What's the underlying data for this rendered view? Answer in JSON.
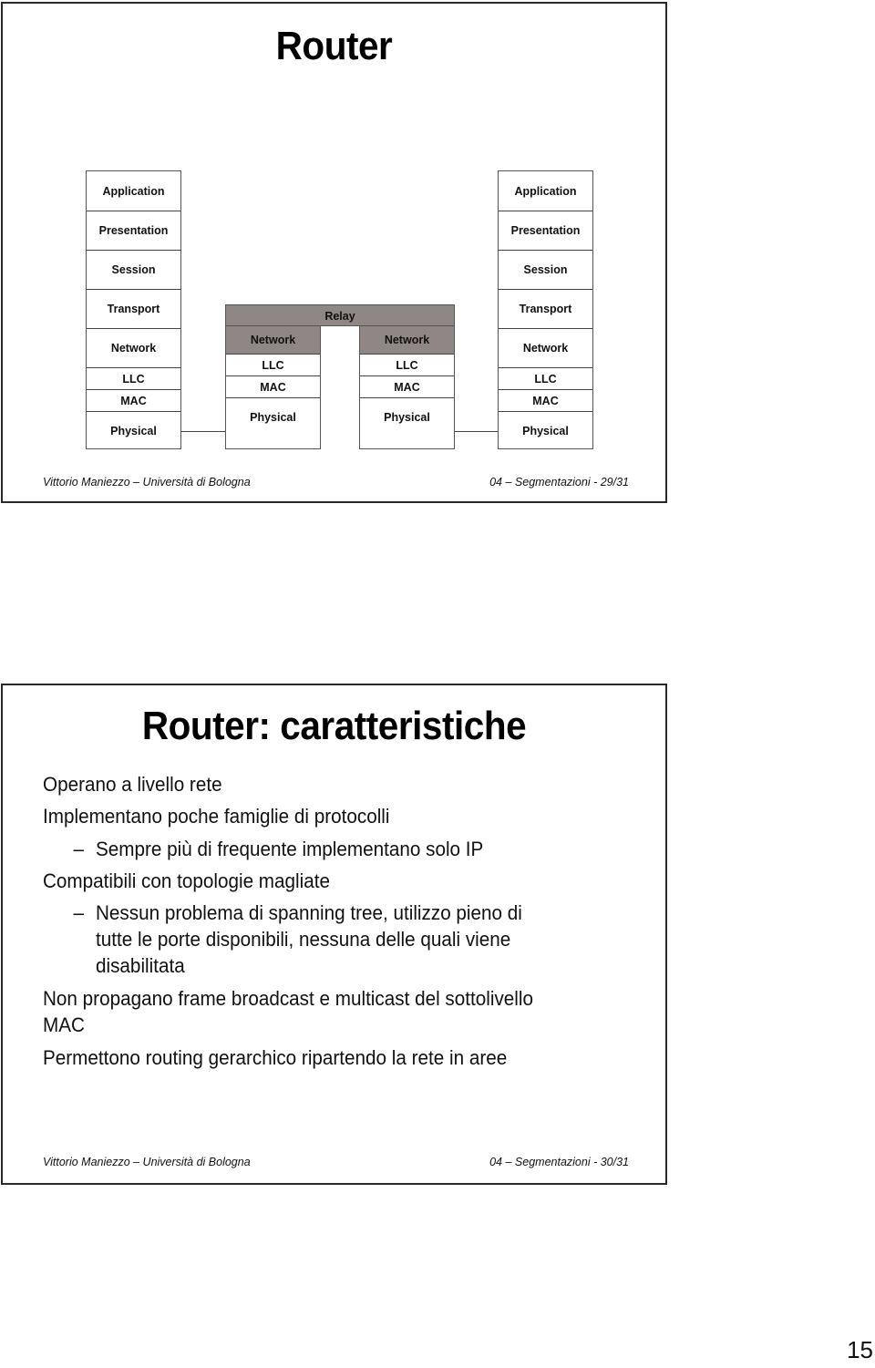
{
  "slides": [
    {
      "title": "Router",
      "diagram": {
        "end_stack_layers": [
          "Application",
          "Presentation",
          "Session",
          "Transport",
          "Network",
          "LLC",
          "MAC",
          "Physical"
        ],
        "relay_label": "Relay",
        "relay_stack_layers": [
          "Network",
          "LLC",
          "MAC",
          "Physical"
        ],
        "shaded_color": "#8f8786"
      },
      "footer_left": "Vittorio Maniezzo – Università di Bologna",
      "footer_right": "04 – Segmentazioni - 29/31"
    },
    {
      "title": "Router: caratteristiche",
      "bullets": [
        {
          "level": 1,
          "text": "Operano a livello rete"
        },
        {
          "level": 1,
          "text": "Implementano poche famiglie di protocolli"
        },
        {
          "level": 2,
          "dash": "–",
          "text": "Sempre più di frequente implementano solo IP"
        },
        {
          "level": 1,
          "text": "Compatibili con topologie magliate"
        },
        {
          "level": 2,
          "dash": "–",
          "lines": [
            "Nessun problema di spanning tree, utilizzo pieno di",
            "tutte le porte disponibili, nessuna delle quali viene",
            "disabilitata"
          ]
        },
        {
          "level": 1,
          "lines": [
            "Non propagano frame broadcast e multicast del sottolivello",
            "MAC"
          ]
        },
        {
          "level": 1,
          "text": "Permettono routing gerarchico ripartendo la rete in aree"
        }
      ],
      "footer_left": "Vittorio Maniezzo – Università di Bologna",
      "footer_right": "04 – Segmentazioni - 30/31"
    }
  ],
  "page_number": "15"
}
